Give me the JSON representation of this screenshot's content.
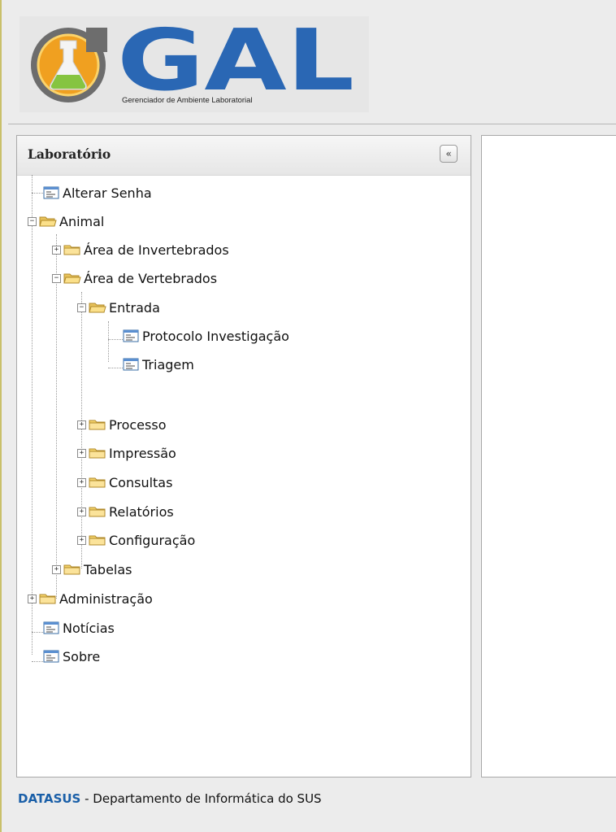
{
  "header": {
    "logo_text": "GAL",
    "logo_subtitle": "Gerenciador de Ambiente Laboratorial"
  },
  "sidebar": {
    "title": "Laboratório",
    "collapse_label": "«",
    "items": {
      "alterar_senha": "Alterar Senha",
      "animal": "Animal",
      "area_invertebrados": "Área de Invertebrados",
      "area_vertebrados": "Área de Vertebrados",
      "entrada": "Entrada",
      "protocolo_investigacao": "Protocolo Investigação",
      "triagem": "Triagem",
      "processo": "Processo",
      "impressao": "Impressão",
      "consultas": "Consultas",
      "relatorios": "Relatórios",
      "configuracao": "Configuração",
      "tabelas": "Tabelas",
      "administracao": "Administração",
      "noticias": "Notícias",
      "sobre": "Sobre"
    }
  },
  "tree_state": {
    "expand_collapsed": "+",
    "expand_expanded": "−"
  },
  "footer": {
    "brand": "DATASUS",
    "text": " - Departamento de Informática do SUS"
  },
  "colors": {
    "brand_blue": "#1a5fa8",
    "folder_yellow": "#f3d26a",
    "left_rule": "#c9c06a"
  }
}
